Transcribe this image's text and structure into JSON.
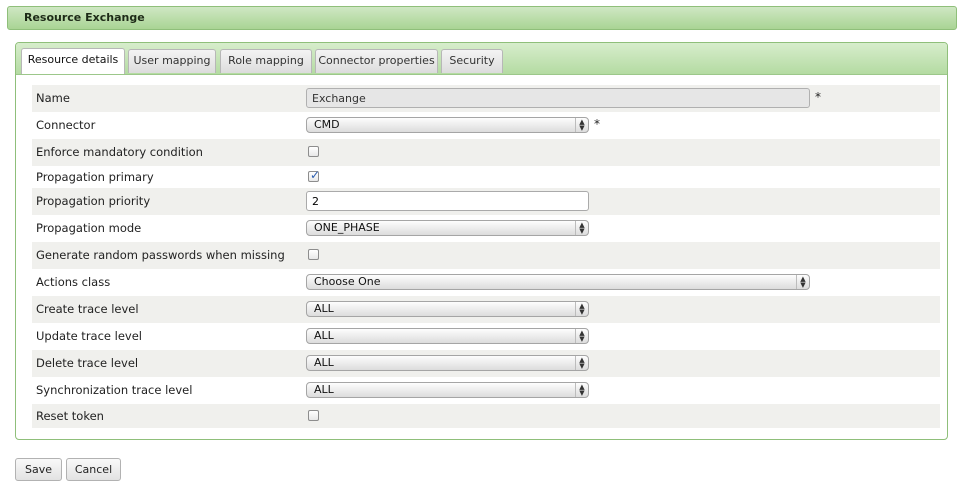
{
  "window": {
    "title": "Resource Exchange"
  },
  "tabs": [
    {
      "label": "Resource details",
      "active": true
    },
    {
      "label": "User mapping",
      "active": false
    },
    {
      "label": "Role mapping",
      "active": false
    },
    {
      "label": "Connector properties",
      "active": false
    },
    {
      "label": "Security",
      "active": false
    }
  ],
  "form": {
    "required_marker": "*",
    "name": {
      "label": "Name",
      "value": "Exchange"
    },
    "connector": {
      "label": "Connector",
      "value": "CMD"
    },
    "enforce_mandatory": {
      "label": "Enforce mandatory condition",
      "checked": false
    },
    "propagation_primary": {
      "label": "Propagation primary",
      "checked": true
    },
    "propagation_priority": {
      "label": "Propagation priority",
      "value": "2"
    },
    "propagation_mode": {
      "label": "Propagation mode",
      "value": "ONE_PHASE"
    },
    "generate_passwords": {
      "label": "Generate random passwords when missing",
      "checked": false
    },
    "actions_class": {
      "label": "Actions class",
      "value": "Choose One"
    },
    "create_trace": {
      "label": "Create trace level",
      "value": "ALL"
    },
    "update_trace": {
      "label": "Update trace level",
      "value": "ALL"
    },
    "delete_trace": {
      "label": "Delete trace level",
      "value": "ALL"
    },
    "sync_trace": {
      "label": "Synchronization trace level",
      "value": "ALL"
    },
    "reset_token": {
      "label": "Reset token",
      "checked": false
    }
  },
  "buttons": {
    "save": "Save",
    "cancel": "Cancel"
  },
  "icons": {
    "select_arrows": "updown-arrows-icon",
    "checkmark": "check-icon"
  },
  "colors": {
    "header_green": "#b4dba2",
    "row_shade": "#f0f0ed",
    "check_blue": "#2d5fb0"
  }
}
